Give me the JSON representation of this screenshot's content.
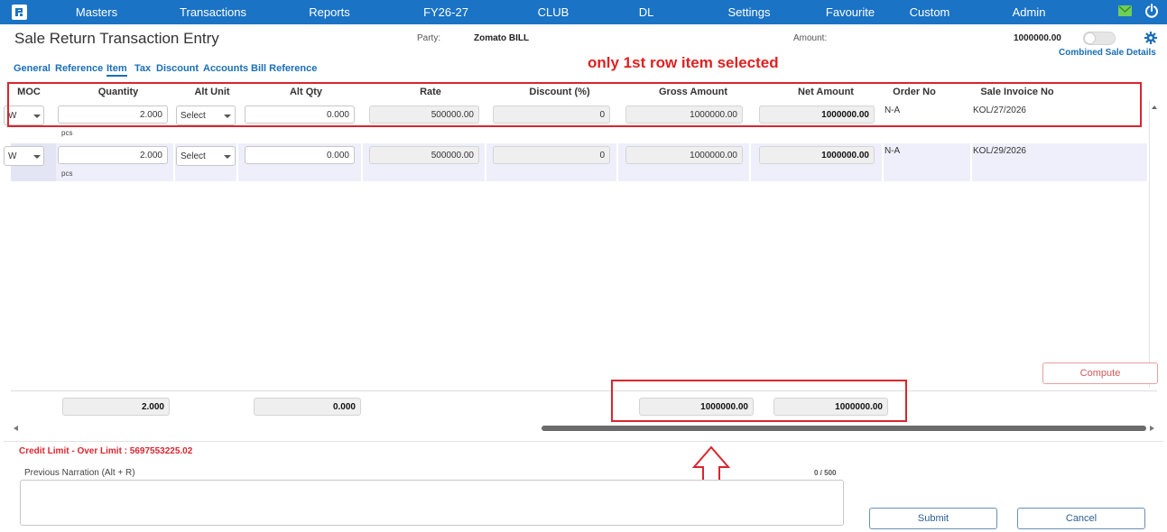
{
  "nav": {
    "items": [
      "Masters",
      "Transactions",
      "Reports",
      "FY26-27",
      "CLUB",
      "DL",
      "Settings",
      "Favourite",
      "Custom",
      "Admin"
    ]
  },
  "header": {
    "title": "Sale Return Transaction Entry",
    "party_label": "Party:",
    "party_value": "Zomato BILL",
    "amount_label": "Amount:",
    "amount_value": "1000000.00",
    "combined_link": "Combined Sale Details"
  },
  "tabs": [
    "General",
    "Reference",
    "Item",
    "Tax",
    "Discount",
    "Accounts",
    "Bill Reference"
  ],
  "annotation": "only 1st row item selected",
  "columns": [
    "MOC",
    "Quantity",
    "Alt Unit",
    "Alt Qty",
    "Rate",
    "Discount (%)",
    "Gross Amount",
    "Net Amount",
    "Order No",
    "Sale Invoice No"
  ],
  "rows": [
    {
      "moc": "W",
      "quantity": "2.000",
      "unit": "pcs",
      "alt_unit": "Select",
      "alt_qty": "0.000",
      "rate": "500000.00",
      "discount": "0",
      "gross": "1000000.00",
      "net": "1000000.00",
      "order_no": "N-A",
      "invoice_no": "KOL/27/2026"
    },
    {
      "moc": "W",
      "quantity": "2.000",
      "unit": "pcs",
      "alt_unit": "Select",
      "alt_qty": "0.000",
      "rate": "500000.00",
      "discount": "0",
      "gross": "1000000.00",
      "net": "1000000.00",
      "order_no": "N-A",
      "invoice_no": "KOL/29/2026"
    }
  ],
  "compute_label": "Compute",
  "totals": {
    "quantity": "2.000",
    "alt_qty": "0.000",
    "gross": "1000000.00",
    "net": "1000000.00"
  },
  "footer": {
    "credit_limit": "Credit Limit - Over Limit : 5697553225.02",
    "narration_label": "Previous Narration (Alt + R)",
    "narration_count": "0 / 500",
    "narration_value": "",
    "submit_label": "Submit",
    "cancel_label": "Cancel"
  },
  "colors": {
    "nav_bg": "#1a73c4",
    "link": "#1a6eb5",
    "annotation": "#d9262f"
  },
  "icons": {
    "logo": "app-logo",
    "mail": "mail-icon",
    "power": "power-icon",
    "settings": "gear-icon"
  }
}
